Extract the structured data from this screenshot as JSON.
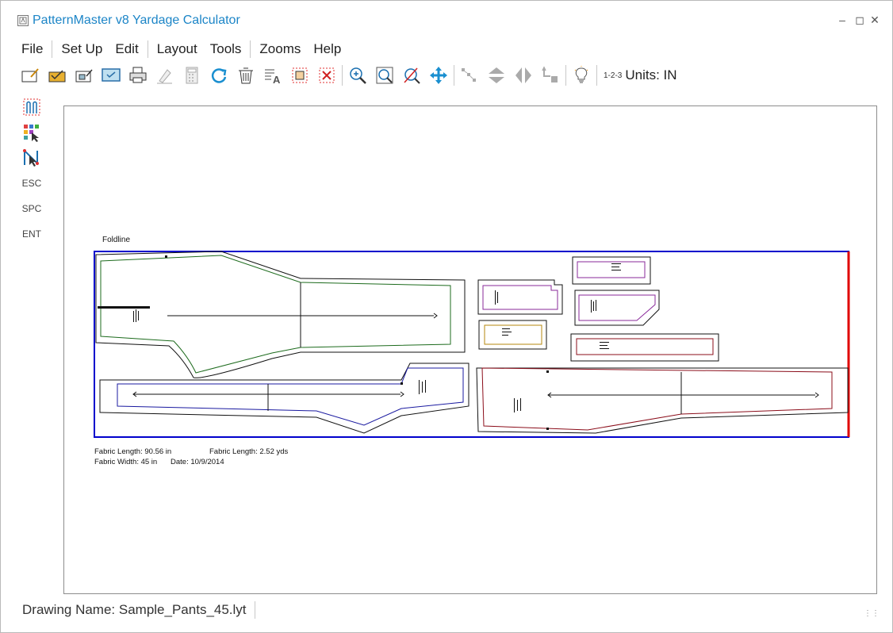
{
  "window": {
    "title": "PatternMaster v8 Yardage Calculator"
  },
  "menu": [
    "File",
    "Set Up",
    "Edit",
    "Layout",
    "Tools",
    "Zooms",
    "Help"
  ],
  "toolbar": {
    "units_icon": "1-2-3",
    "units_label": "Units: IN"
  },
  "side_tools": {
    "esc": "ESC",
    "spc": "SPC",
    "ent": "ENT"
  },
  "layout": {
    "foldline_label": "Foldline",
    "fabric_length_in": "Fabric Length: 90.56 in",
    "fabric_length_yds": "Fabric Length: 2.52 yds",
    "fabric_width": "Fabric Width: 45 in",
    "date": "Date:  10/9/2014"
  },
  "status": {
    "drawing_name": "Drawing Name: Sample_Pants_45.lyt"
  },
  "colors": {
    "title": "#1c85c7",
    "fabric_border": "#0000cc",
    "fold_edge": "#e00000",
    "piece_green": "#1d6b1d",
    "piece_blue": "#1a1aa0",
    "piece_maroon": "#8b0d1a",
    "piece_purple": "#8a2a9a",
    "piece_gold": "#b5870e"
  }
}
